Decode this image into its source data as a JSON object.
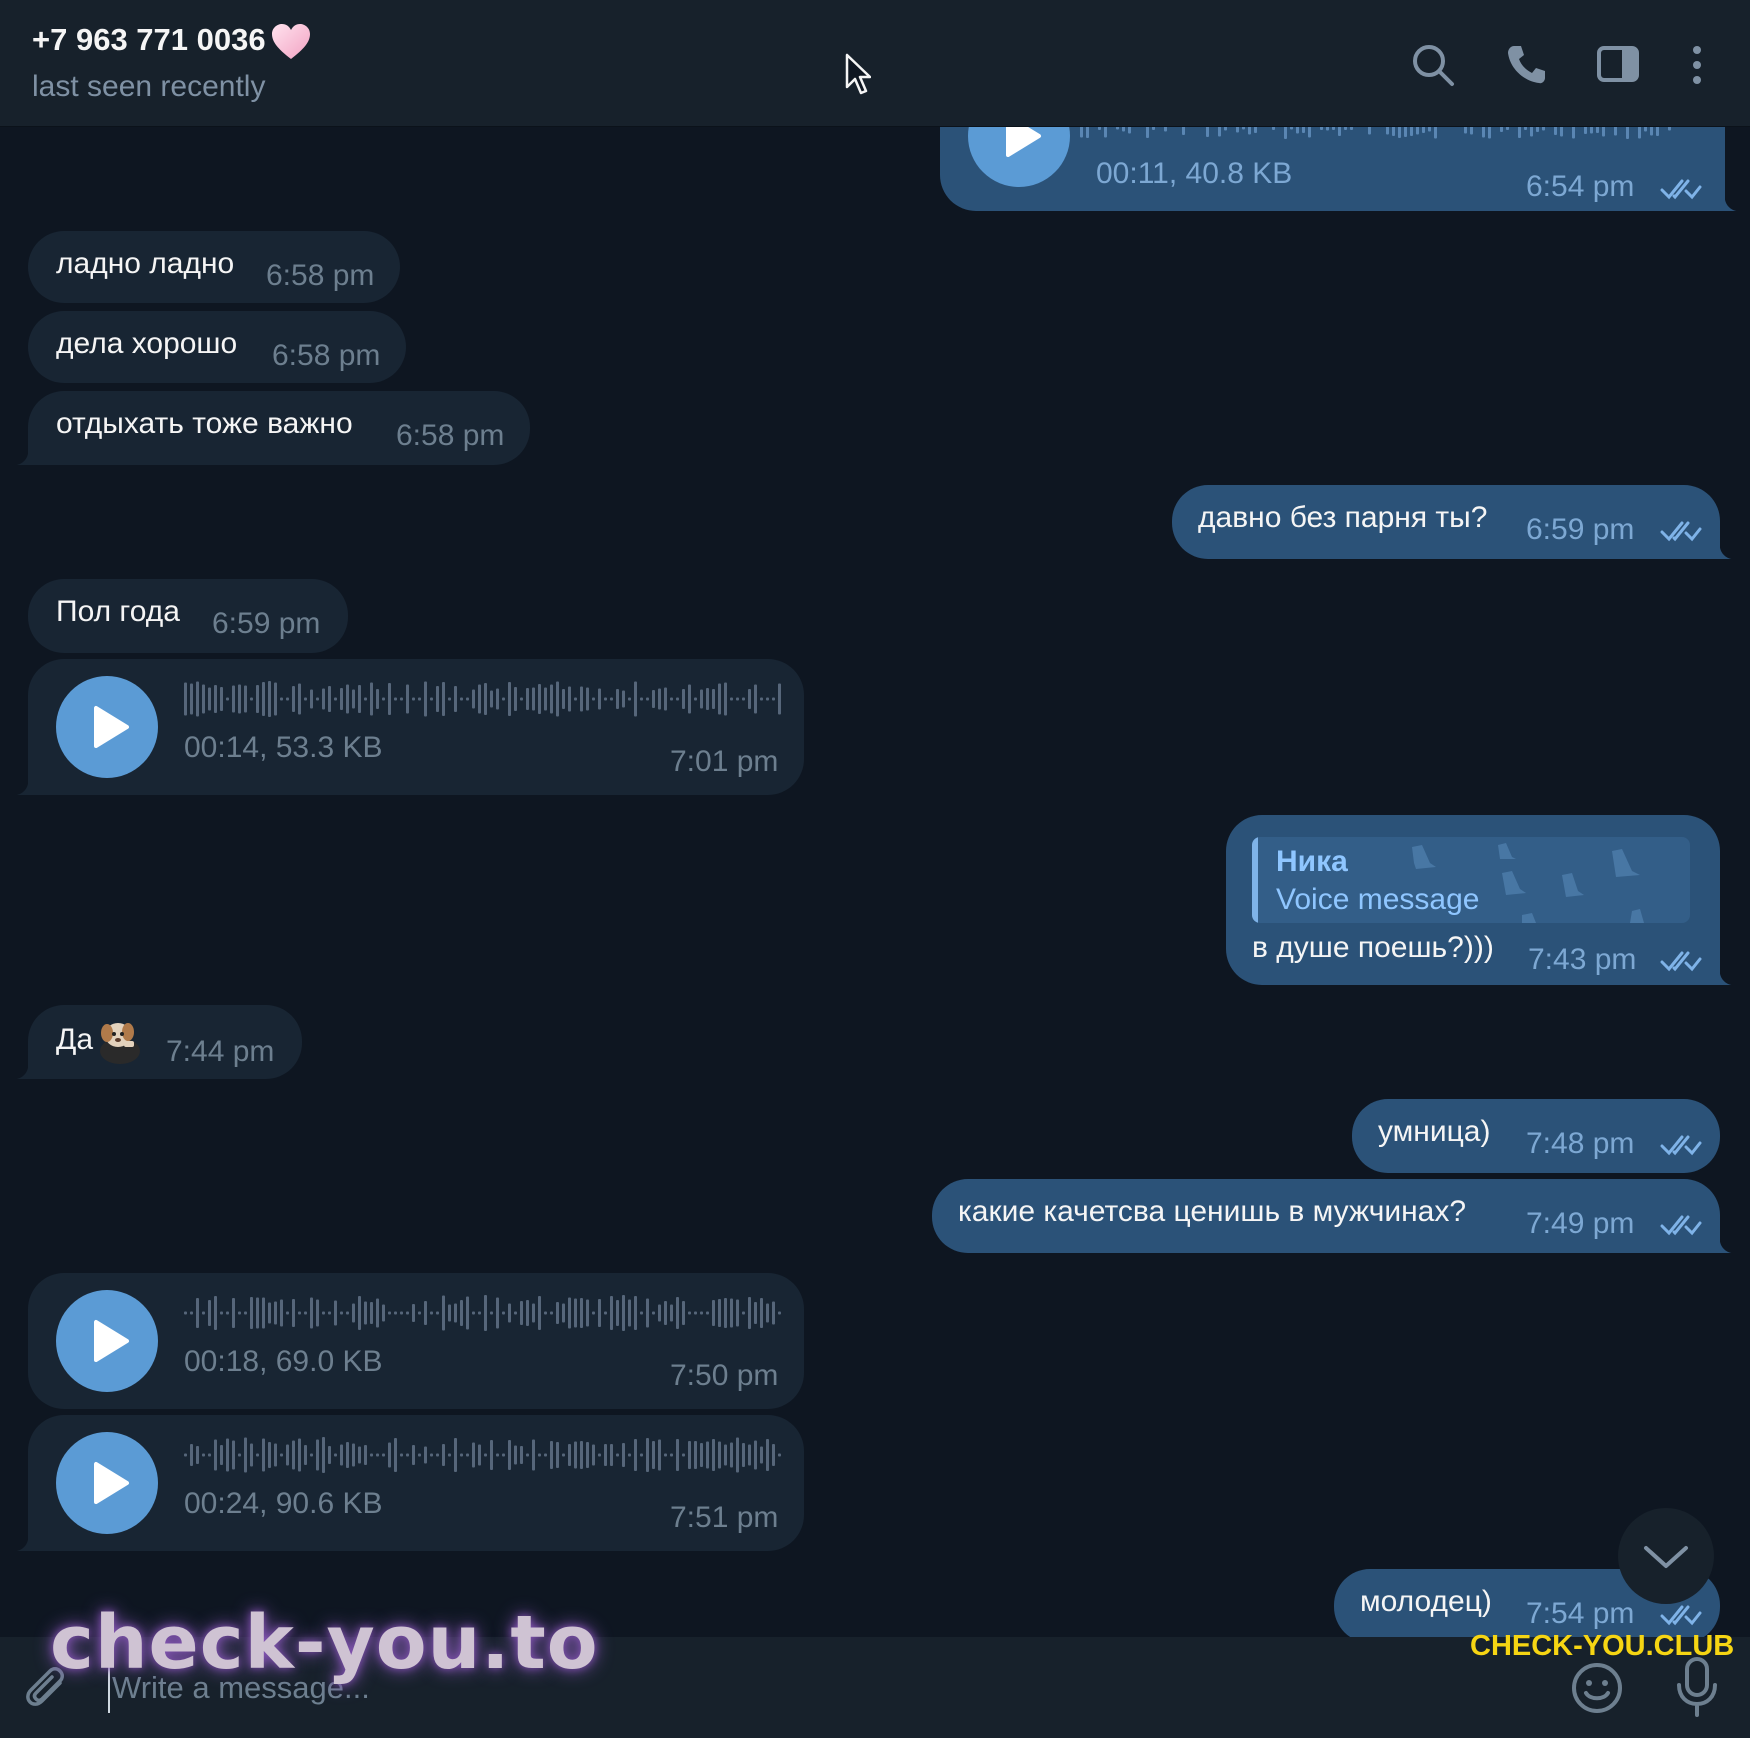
{
  "header": {
    "contact_name": "+7 963 771 0036",
    "status": "last seen recently",
    "icons": [
      "search-icon",
      "phone-icon",
      "sidebar-toggle-icon",
      "more-vertical-icon"
    ]
  },
  "messages": [
    {
      "direction": "out",
      "type": "voice",
      "meta": "00:11, 40.8 KB",
      "time": "6:54 pm",
      "read": true
    },
    {
      "direction": "in",
      "type": "text",
      "text": "ладно ладно",
      "time": "6:58 pm"
    },
    {
      "direction": "in",
      "type": "text",
      "text": "дела хорошо",
      "time": "6:58 pm"
    },
    {
      "direction": "in",
      "type": "text",
      "text": "отдыхать тоже важно",
      "time": "6:58 pm"
    },
    {
      "direction": "out",
      "type": "text",
      "text": "давно без парня ты?",
      "time": "6:59 pm",
      "read": true
    },
    {
      "direction": "in",
      "type": "text",
      "text": "Пол года",
      "time": "6:59 pm"
    },
    {
      "direction": "in",
      "type": "voice",
      "meta": "00:14, 53.3 KB",
      "time": "7:01 pm"
    },
    {
      "direction": "out",
      "type": "reply",
      "reply_name": "Ника",
      "reply_text": "Voice message",
      "text": "в душе поешь?)))",
      "time": "7:43 pm",
      "read": true
    },
    {
      "direction": "in",
      "type": "text",
      "text": "Да",
      "emoji": "puppy-sticker",
      "time": "7:44 pm"
    },
    {
      "direction": "out",
      "type": "text",
      "text": "умница)",
      "time": "7:48 pm",
      "read": true
    },
    {
      "direction": "out",
      "type": "text",
      "text": "какие качетсва ценишь в мужчинах?",
      "time": "7:49 pm",
      "read": true
    },
    {
      "direction": "in",
      "type": "voice",
      "meta": "00:18, 69.0 KB",
      "time": "7:50 pm"
    },
    {
      "direction": "in",
      "type": "voice",
      "meta": "00:24, 90.6 KB",
      "time": "7:51 pm"
    },
    {
      "direction": "out",
      "type": "text",
      "text": "молодец)",
      "time": "7:54 pm",
      "read": true
    }
  ],
  "composer": {
    "placeholder": "Write a message...",
    "icons": [
      "attach-icon",
      "emoji-icon",
      "microphone-icon"
    ]
  },
  "watermarks": [
    "check-you.to",
    "CHECK-YOU.CLUB"
  ],
  "colors": {
    "background": "#0e1621",
    "header": "#17212b",
    "incoming_bubble": "#182533",
    "outgoing_bubble": "#2b5278",
    "accent": "#5b9bd5"
  }
}
